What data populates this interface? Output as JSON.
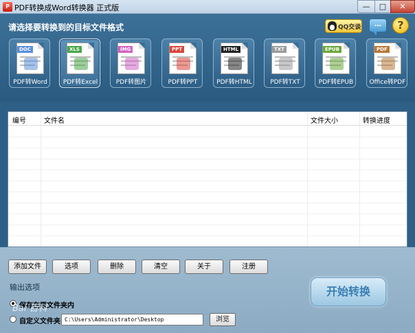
{
  "window": {
    "title": "PDF转换成Word转换器 正式版",
    "app_icon": "P",
    "min_glyph": "—",
    "max_glyph": "□",
    "close_glyph": "✕"
  },
  "header": {
    "title": "请选择要转换到的目标文件格式",
    "qq_button": "QQ交谈",
    "chat_glyph": "…",
    "help_glyph": "?"
  },
  "formats": [
    {
      "tag": "DOC",
      "label": "PDF转Word",
      "color": "#5b8fd8",
      "icon": "word-doc-icon"
    },
    {
      "tag": "XLS",
      "label": "PDF转Excel",
      "color": "#4aa54a",
      "icon": "excel-chart-icon",
      "selected": true
    },
    {
      "tag": "IMG",
      "label": "PDF转图片",
      "color": "#d064c4",
      "icon": "image-icon"
    },
    {
      "tag": "PPT",
      "label": "PDF转PPT",
      "color": "#d9463a",
      "icon": "ppt-icon"
    },
    {
      "tag": "HTML",
      "label": "PDF转HTML",
      "color": "#222222",
      "icon": "html-globe-icon"
    },
    {
      "tag": "TXT",
      "label": "PDF转TXT",
      "color": "#9a9a9a",
      "icon": "txt-icon"
    },
    {
      "tag": "EPUB",
      "label": "PDF转EPUB",
      "color": "#6aa83a",
      "icon": "epub-icon"
    },
    {
      "tag": "PDF",
      "label": "Office转PDF",
      "color": "#b87a3a",
      "icon": "pdf-acrobat-icon"
    }
  ],
  "table": {
    "columns": [
      "编号",
      "文件名",
      "文件大小",
      "转换进度"
    ]
  },
  "actions": [
    "添加文件",
    "选项",
    "删除",
    "清空",
    "关于",
    "注册"
  ],
  "output": {
    "title": "输出选项",
    "option_same": "保存在原文件夹内",
    "option_custom": "自定义文件夹",
    "path": "C:\\Users\\Administrator\\Desktop",
    "browse": "浏览",
    "selected": "same"
  },
  "start_button": "开始转换",
  "watermark": "Bai 百科"
}
